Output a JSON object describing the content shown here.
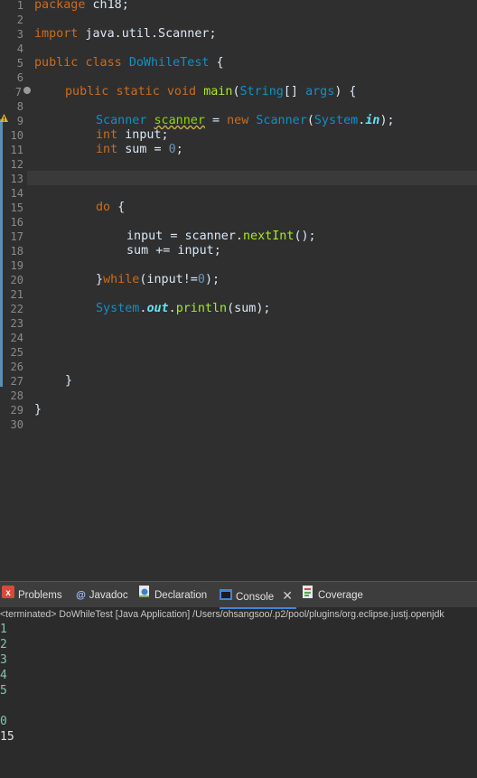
{
  "editor": {
    "line_numbers": [
      "1",
      "2",
      "3",
      "4",
      "5",
      "6",
      "7",
      "8",
      "9",
      "10",
      "11",
      "12",
      "13",
      "14",
      "15",
      "16",
      "17",
      "18",
      "19",
      "20",
      "21",
      "22",
      "23",
      "24",
      "25",
      "26",
      "27",
      "28",
      "29",
      "30"
    ],
    "code": {
      "l1_kw": "package",
      "l1_rest": " ch18;",
      "l3_kw": "import",
      "l3_rest": " java.util.Scanner;",
      "l5_kw1": "public",
      "l5_kw2": "class",
      "l5_name": "DoWhileTest",
      "l5_brace": " {",
      "l7_kw1": "public",
      "l7_kw2": "static",
      "l7_kw3": "void",
      "l7_mth": "main",
      "l7_p1": "(",
      "l7_type": "String",
      "l7_p2": "[] ",
      "l7_args": "args",
      "l7_p3": ") {",
      "l9_type": "Scanner",
      "l9_var": "scanner",
      "l9_eq": " = ",
      "l9_new": "new",
      "l9_type2": "Scanner",
      "l9_p1": "(",
      "l9_sys": "System",
      "l9_dot": ".",
      "l9_in": "in",
      "l9_p2": ");",
      "l10_kw": "int",
      "l10_rest": " input;",
      "l11_kw": "int",
      "l11_rest": " sum = ",
      "l11_num": "0",
      "l11_semi": ";",
      "l15_kw": "do",
      "l15_rest": " {",
      "l17_a": "input = scanner.",
      "l17_mth": "nextInt",
      "l17_b": "();",
      "l18": "sum += input;",
      "l20_a": "}",
      "l20_kw": "while",
      "l20_b": "(input!=",
      "l20_num": "0",
      "l20_c": ");",
      "l22_sys": "System",
      "l22_dot": ".",
      "l22_out": "out",
      "l22_dot2": ".",
      "l22_mth": "println",
      "l22_b": "(sum);",
      "l27": "}",
      "l29": "}"
    }
  },
  "panel": {
    "tabs": [
      {
        "label": "Problems",
        "icon": "problems-icon"
      },
      {
        "label": "Javadoc",
        "icon": "javadoc-icon"
      },
      {
        "label": "Declaration",
        "icon": "declaration-icon"
      },
      {
        "label": "Console",
        "icon": "console-icon",
        "active": true
      },
      {
        "label": "Coverage",
        "icon": "coverage-icon"
      }
    ],
    "status": "<terminated> DoWhileTest [Java Application] /Users/ohsangsoo/.p2/pool/plugins/org.eclipse.justj.openjdk",
    "console_input_lines": [
      "1",
      "2",
      "3",
      "4",
      "5",
      "",
      "0"
    ],
    "console_output": "15"
  }
}
